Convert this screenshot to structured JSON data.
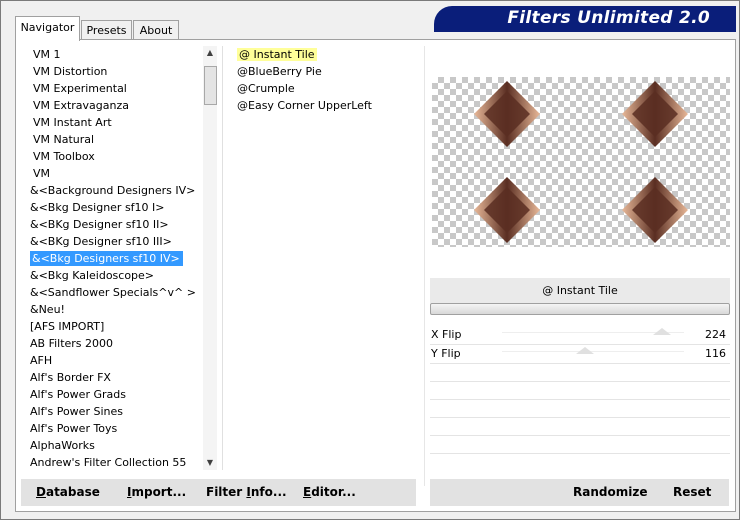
{
  "tabs": [
    {
      "label": "Navigator",
      "active": true
    },
    {
      "label": "Presets",
      "active": false
    },
    {
      "label": "About",
      "active": false
    }
  ],
  "title": "Filters Unlimited 2.0",
  "categories": [
    {
      "label": "VM 1",
      "indent": true
    },
    {
      "label": "VM Distortion",
      "indent": true
    },
    {
      "label": "VM Experimental",
      "indent": true
    },
    {
      "label": "VM Extravaganza",
      "indent": true
    },
    {
      "label": "VM Instant Art",
      "indent": true
    },
    {
      "label": "VM Natural",
      "indent": true
    },
    {
      "label": "VM Toolbox",
      "indent": true
    },
    {
      "label": "VM",
      "indent": true
    },
    {
      "label": "&<Background Designers IV>",
      "indent": false
    },
    {
      "label": "&<Bkg Designer sf10 I>",
      "indent": false
    },
    {
      "label": "&<BKg Designer sf10 II>",
      "indent": false
    },
    {
      "label": "&<BKg Designer sf10 III>",
      "indent": false
    },
    {
      "label": "&<Bkg Designers sf10 IV>",
      "indent": false,
      "selected": true
    },
    {
      "label": "&<Bkg Kaleidoscope>",
      "indent": false
    },
    {
      "label": "&<Sandflower Specials^v^ >",
      "indent": false
    },
    {
      "label": "&Neu!",
      "indent": false
    },
    {
      "label": "[AFS IMPORT]",
      "indent": false
    },
    {
      "label": "AB Filters 2000",
      "indent": false
    },
    {
      "label": "AFH",
      "indent": false
    },
    {
      "label": "Alf's Border FX",
      "indent": false
    },
    {
      "label": "Alf's Power Grads",
      "indent": false
    },
    {
      "label": "Alf's Power Sines",
      "indent": false
    },
    {
      "label": "Alf's Power Toys",
      "indent": false
    },
    {
      "label": "AlphaWorks",
      "indent": false
    },
    {
      "label": "Andrew's Filter Collection 55",
      "indent": false
    }
  ],
  "filters": [
    {
      "label": "@ Instant Tile",
      "highlighted": true
    },
    {
      "label": "@BlueBerry Pie",
      "highlighted": false
    },
    {
      "label": "@Crumple",
      "highlighted": false
    },
    {
      "label": "@Easy Corner UpperLeft",
      "highlighted": false
    }
  ],
  "selected_filter_name": "@ Instant Tile",
  "sliders": [
    {
      "label": "X Flip",
      "value": 224,
      "max": 255
    },
    {
      "label": "Y Flip",
      "value": 116,
      "max": 255
    }
  ],
  "buttons": {
    "database": {
      "pre": "",
      "u": "D",
      "post": "atabase"
    },
    "import": {
      "pre": "",
      "u": "I",
      "post": "mport..."
    },
    "filter_info": {
      "pre": "Filter ",
      "u": "I",
      "post": "nfo..."
    },
    "editor": {
      "pre": "",
      "u": "E",
      "post": "ditor..."
    },
    "randomize": {
      "label": "Randomize"
    },
    "reset": {
      "label": "Reset"
    }
  },
  "colors": {
    "banner": "#0a1e7a",
    "selection": "#3399ff",
    "highlight": "#ffff99",
    "tile_dark": "#5a2e22",
    "tile_light": "#e8b898"
  }
}
